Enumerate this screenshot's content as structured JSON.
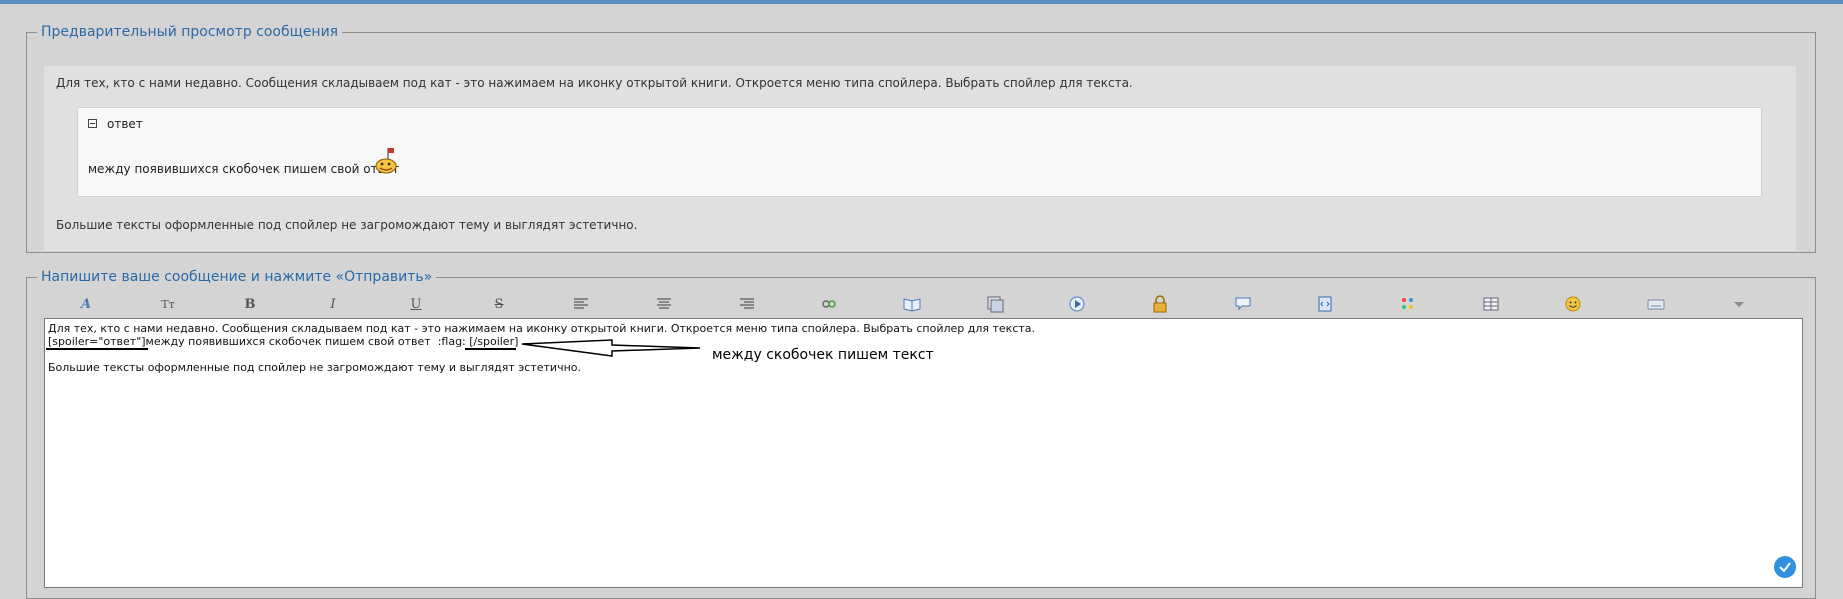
{
  "preview": {
    "legend": "Предварительный просмотр сообщения",
    "intro": "Для тех, кто с нами недавно. Сообщения складываем под кат - это нажимаем на иконку открытой книги. Откроется меню типа спойлера. Выбрать спойлер для текста.",
    "spoiler_title": "ответ",
    "spoiler_body": "между появившихся скобочек пишем свой ответ",
    "outro": "Большие тексты оформленные под спойлер не загромождают тему и выглядят эстетично."
  },
  "compose": {
    "legend": "Напишите ваше сообщение и нажмите «Отправить»",
    "editor_lines": [
      "Для тех, кто с нами недавно. Сообщения складываем под кат - это нажимаем на иконку открытой книги. Откроется меню типа спойлера. Выбрать спойлер для текста.",
      "[spoiler=\"ответ\"]между появившихся скобочек пишем свой ответ  :flag: [/spoiler]",
      "",
      "Большие тексты оформленные под спойлер не загромождают тему и выглядят эстетично."
    ]
  },
  "annotation": {
    "text": "между скобочек пишем текст"
  },
  "toolbar": {
    "font_glyph": "A",
    "size_glyph": "Tт",
    "bold_glyph": "B",
    "italic_glyph": "I",
    "underline_glyph": "U",
    "strike_glyph": "S"
  },
  "colors": {
    "accent": "#2a6aa6",
    "page_bg": "#d4d4d4",
    "preview_bg": "#dfe1df"
  }
}
